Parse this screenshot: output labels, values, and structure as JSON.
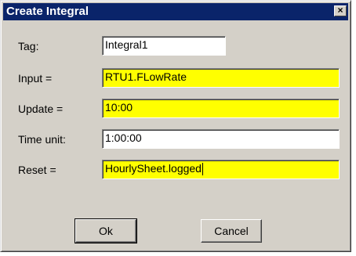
{
  "window": {
    "title": "Create Integral",
    "close_label": "×"
  },
  "form": {
    "tag": {
      "label": "Tag:",
      "value": "Integral1"
    },
    "input": {
      "label": "Input =",
      "value": "RTU1.FLowRate"
    },
    "update": {
      "label": "Update =",
      "value": "10:00"
    },
    "time_unit": {
      "label": "Time unit:",
      "value": "1:00:00"
    },
    "reset": {
      "label": "Reset =",
      "value": "HourlySheet.logged"
    }
  },
  "buttons": {
    "ok_label": "Ok",
    "cancel_label": "Cancel"
  },
  "colors": {
    "titlebar": "#0a246a",
    "dialog_face": "#d4d0c8",
    "highlight_field": "#ffff00",
    "plain_field": "#ffffff"
  },
  "icons": {
    "close": "close-icon"
  }
}
